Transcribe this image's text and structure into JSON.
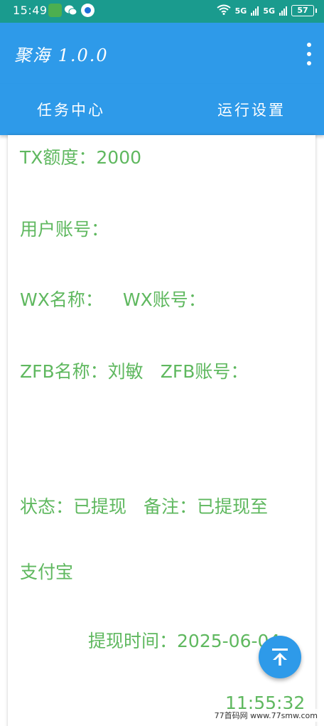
{
  "status_bar": {
    "time": "15:49",
    "network_a": "5G",
    "network_b": "5G",
    "battery": "57"
  },
  "app_bar": {
    "title": "聚海 1.0.0",
    "menu_icon": "more-vert-icon"
  },
  "tabs": [
    {
      "label": "任务中心"
    },
    {
      "label": "运行设置"
    }
  ],
  "record": {
    "tx_label": "TX额度：",
    "tx_value": "2000",
    "user_account_label": "用户账号：",
    "user_account_value": "",
    "wx_name_label": "WX名称：",
    "wx_name_value": "",
    "wx_account_label": "WX账号：",
    "wx_account_value": "",
    "zfb_name_label": "ZFB名称：",
    "zfb_name_value": "刘敏",
    "zfb_account_label": "ZFB账号：",
    "zfb_account_value": "",
    "status_label": "状态：",
    "status_value": "已提现",
    "remark_label": "备注：",
    "remark_value_line1": "已提现至",
    "remark_value_line2": "支付宝",
    "withdraw_time_label": "提现时间：",
    "withdraw_date": "2025-06-04",
    "withdraw_time": "11:55:32"
  },
  "fab": {
    "icon": "arrow-up-to-top-icon"
  },
  "watermark": {
    "text": "77首码网 www.77smw.com"
  },
  "colors": {
    "status_bar": "#1a9b8e",
    "app_bar": "#2e9ae9",
    "text_green": "#5fb85f"
  }
}
